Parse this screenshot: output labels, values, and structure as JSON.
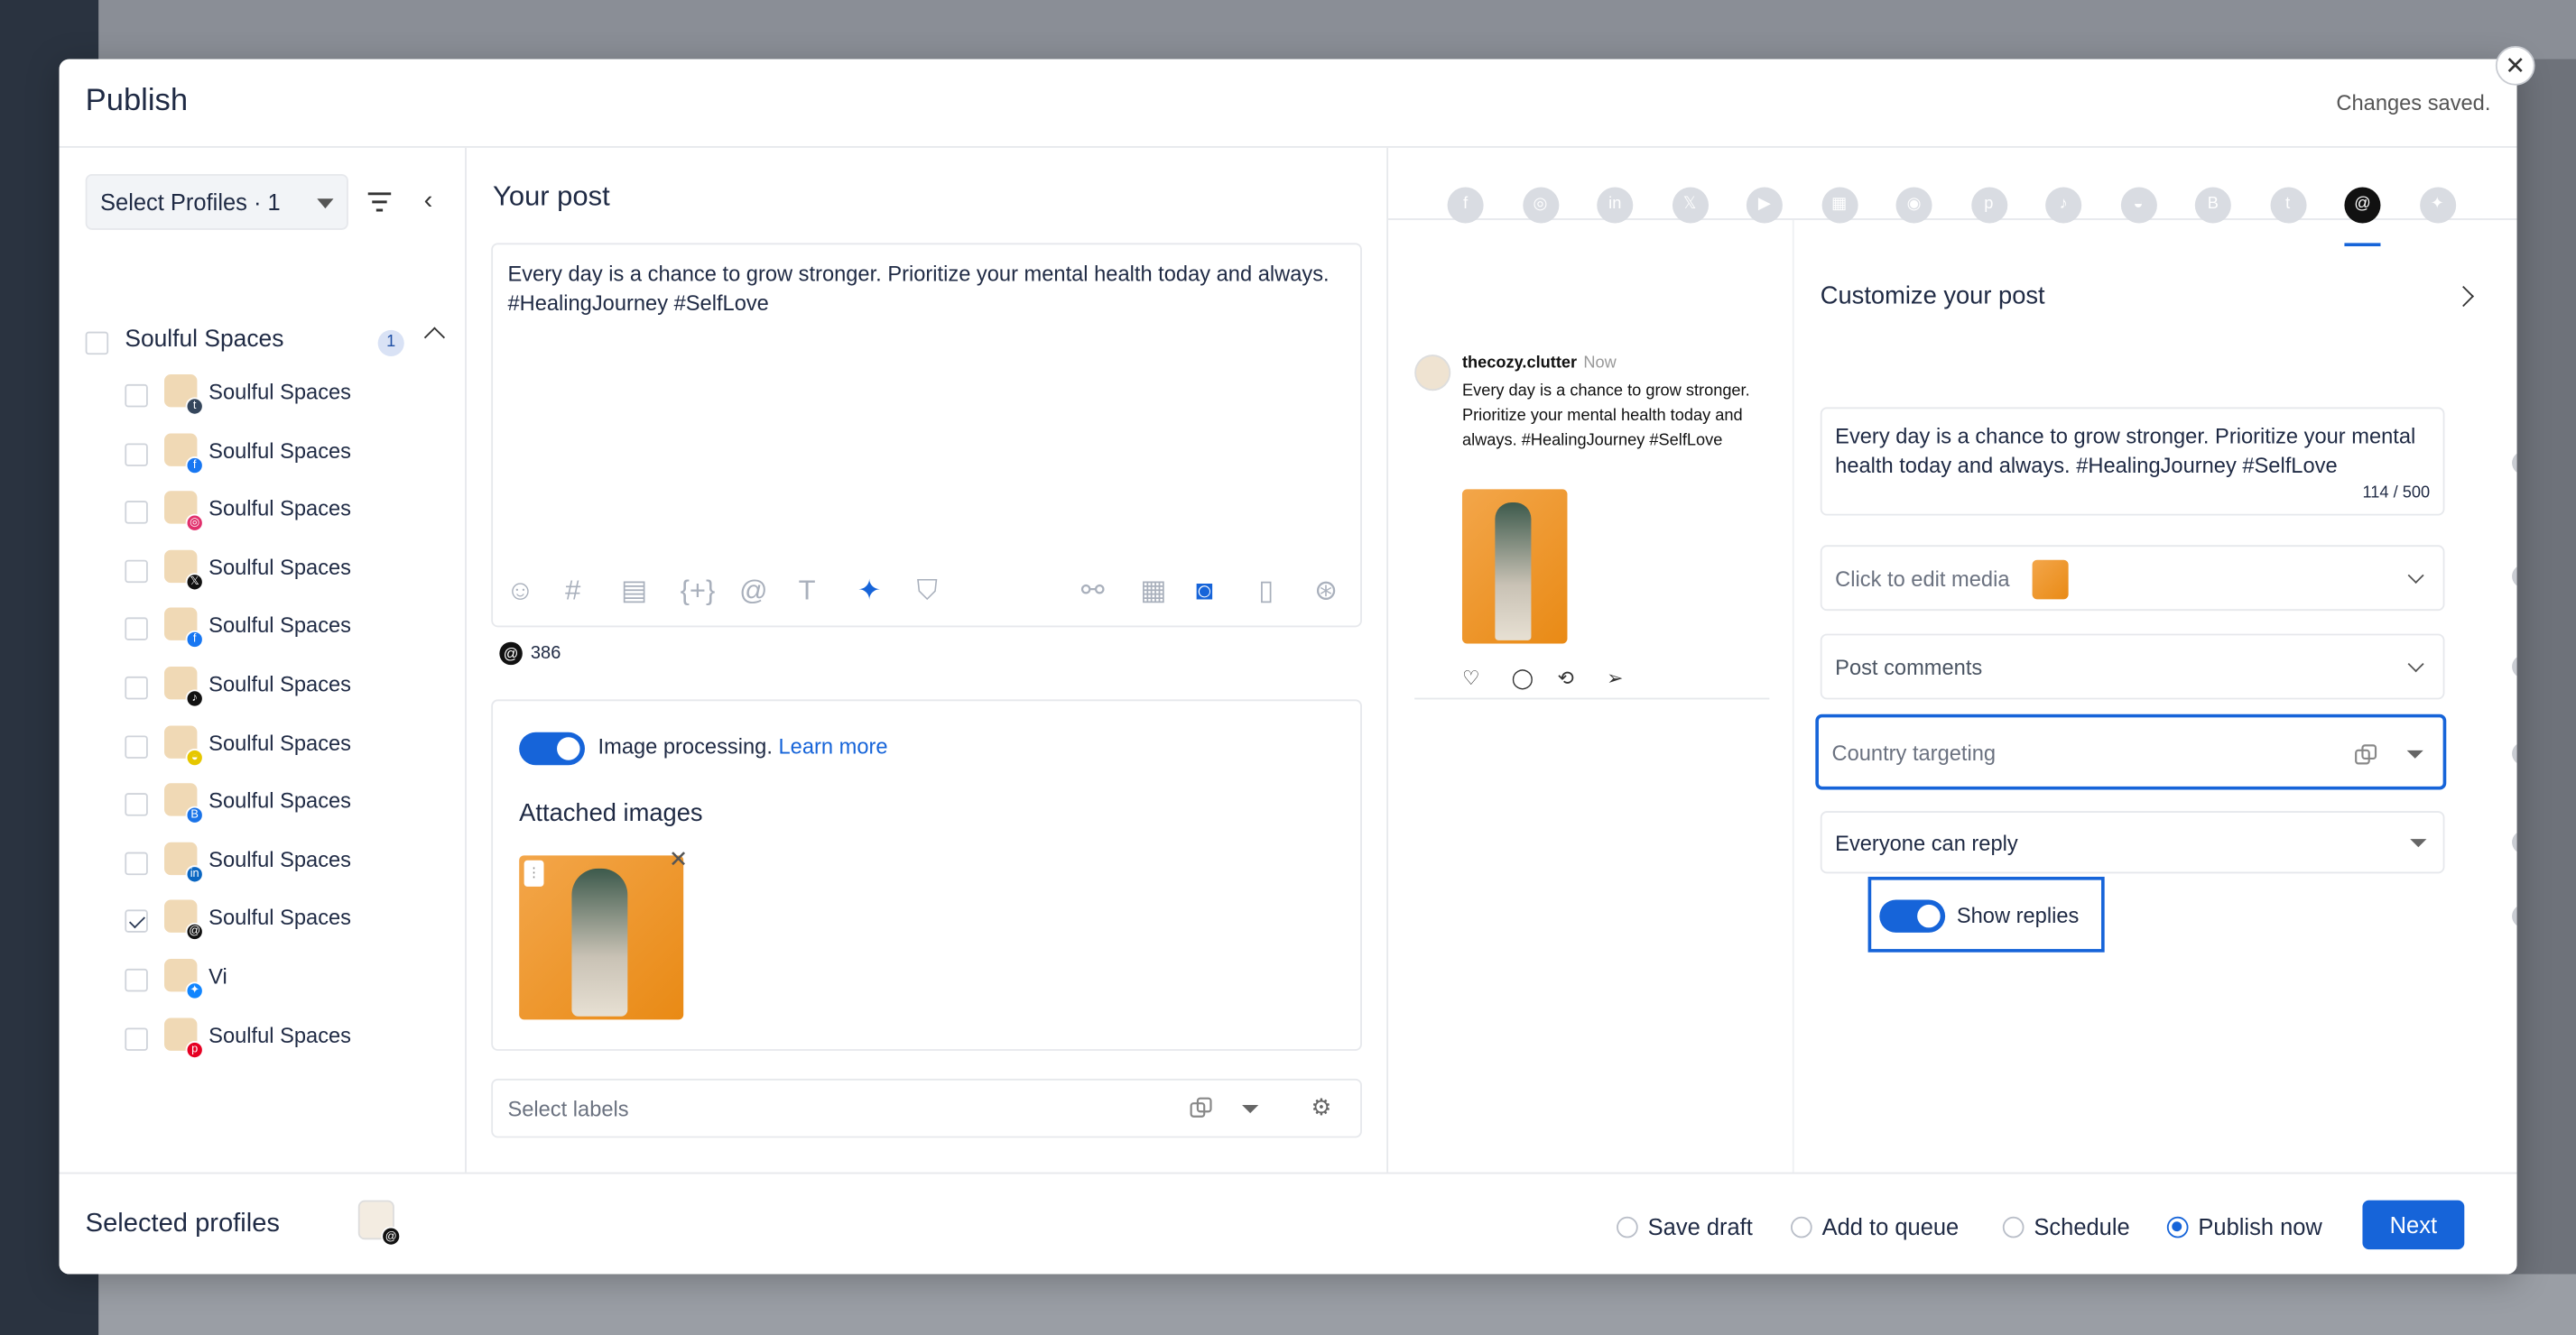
{
  "modal": {
    "title": "Publish",
    "status": "Changes saved."
  },
  "left": {
    "select_profiles": "Select Profiles · 1",
    "group": {
      "label": "Soulful Spaces",
      "count": "1"
    },
    "profiles": [
      {
        "label": "Soulful Spaces",
        "network": "tumblr",
        "checked": false,
        "badge": "t",
        "color": "#35465c"
      },
      {
        "label": "Soulful Spaces",
        "network": "facebook",
        "checked": false,
        "badge": "f",
        "color": "#1877f2"
      },
      {
        "label": "Soulful Spaces",
        "network": "instagram",
        "checked": false,
        "badge": "◎",
        "color": "#e1306c"
      },
      {
        "label": "Soulful Spaces",
        "network": "x",
        "checked": false,
        "badge": "𝕏",
        "color": "#111"
      },
      {
        "label": "Soulful Spaces",
        "network": "facebook",
        "checked": false,
        "badge": "f",
        "color": "#1877f2"
      },
      {
        "label": "Soulful Spaces",
        "network": "tiktok",
        "checked": false,
        "badge": "♪",
        "color": "#111"
      },
      {
        "label": "Soulful Spaces",
        "network": "snapchat",
        "checked": false,
        "badge": "◒",
        "color": "#e6c700"
      },
      {
        "label": "Soulful Spaces",
        "network": "google-business",
        "checked": false,
        "badge": "B",
        "color": "#1a73e8"
      },
      {
        "label": "Soulful Spaces",
        "network": "linkedin",
        "checked": false,
        "badge": "in",
        "color": "#0a66c2"
      },
      {
        "label": "Soulful Spaces",
        "network": "threads",
        "checked": true,
        "badge": "@",
        "color": "#111"
      },
      {
        "label": "Vi",
        "network": "bluesky",
        "checked": false,
        "badge": "✦",
        "color": "#1185fe"
      },
      {
        "label": "Soulful Spaces",
        "network": "pinterest",
        "checked": false,
        "badge": "p",
        "color": "#e60023"
      }
    ]
  },
  "mid": {
    "title": "Your post",
    "post_text": "Every day is a chance to grow stronger. Prioritize your mental health today and always. #HealingJourney #SelfLove",
    "char_remaining": "386",
    "image_processing": "Image processing.",
    "learn_more": "Learn more",
    "attached_images": "Attached images",
    "labels_placeholder": "Select labels"
  },
  "right": {
    "networks": [
      "facebook",
      "instagram",
      "linkedin",
      "x",
      "youtube",
      "google-business",
      "reddit",
      "pinterest",
      "tiktok",
      "snapchat",
      "blogger",
      "tumblr",
      "threads",
      "bluesky"
    ],
    "active_network": "threads",
    "preview": {
      "username": "thecozy.clutter",
      "time": "Now",
      "text": "Every day is a chance to grow stronger. Prioritize your mental health today and always. #HealingJourney #SelfLove"
    },
    "customize_title": "Customize your post",
    "custom_text": "Every day is a chance to grow stronger. Prioritize your mental health today and always. #HealingJourney #SelfLove",
    "custom_count": "114 / 500",
    "edit_media": "Click to edit media",
    "post_comments": "Post comments",
    "country_targeting": "Country targeting",
    "reply_setting": "Everyone can reply",
    "show_replies": "Show replies"
  },
  "footer": {
    "selected_profiles": "Selected profiles",
    "options": [
      "Save draft",
      "Add to queue",
      "Schedule",
      "Publish now"
    ],
    "selected_option": "Publish now",
    "next": "Next"
  },
  "colors": {
    "accent": "#1664d9",
    "text": "#1f2a44"
  }
}
